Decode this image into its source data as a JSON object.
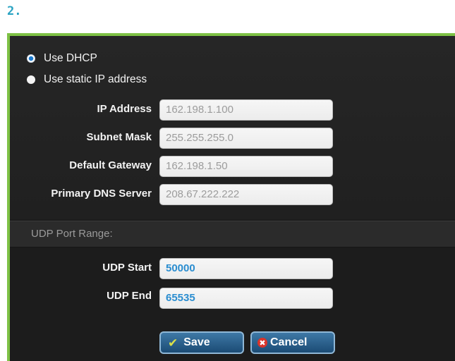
{
  "step_label": "2.",
  "network": {
    "options": [
      {
        "label": "Use DHCP",
        "selected": true
      },
      {
        "label": "Use static IP address",
        "selected": false
      }
    ],
    "fields": [
      {
        "label": "IP Address",
        "value": "162.198.1.100"
      },
      {
        "label": "Subnet Mask",
        "value": "255.255.255.0"
      },
      {
        "label": "Default Gateway",
        "value": "162.198.1.50"
      },
      {
        "label": "Primary DNS  Server",
        "value": "208.67.222.222"
      }
    ]
  },
  "udp": {
    "section_title": "UDP Port Range:",
    "fields": [
      {
        "label": "UDP Start",
        "value": "50000"
      },
      {
        "label": "UDP End",
        "value": "65535"
      }
    ]
  },
  "buttons": {
    "save": "Save",
    "cancel": "Cancel"
  },
  "colors": {
    "accent_border": "#7ec145",
    "step_color": "#2aa3c2",
    "button_blue": "#2d6590",
    "active_value": "#2a8dd0"
  }
}
